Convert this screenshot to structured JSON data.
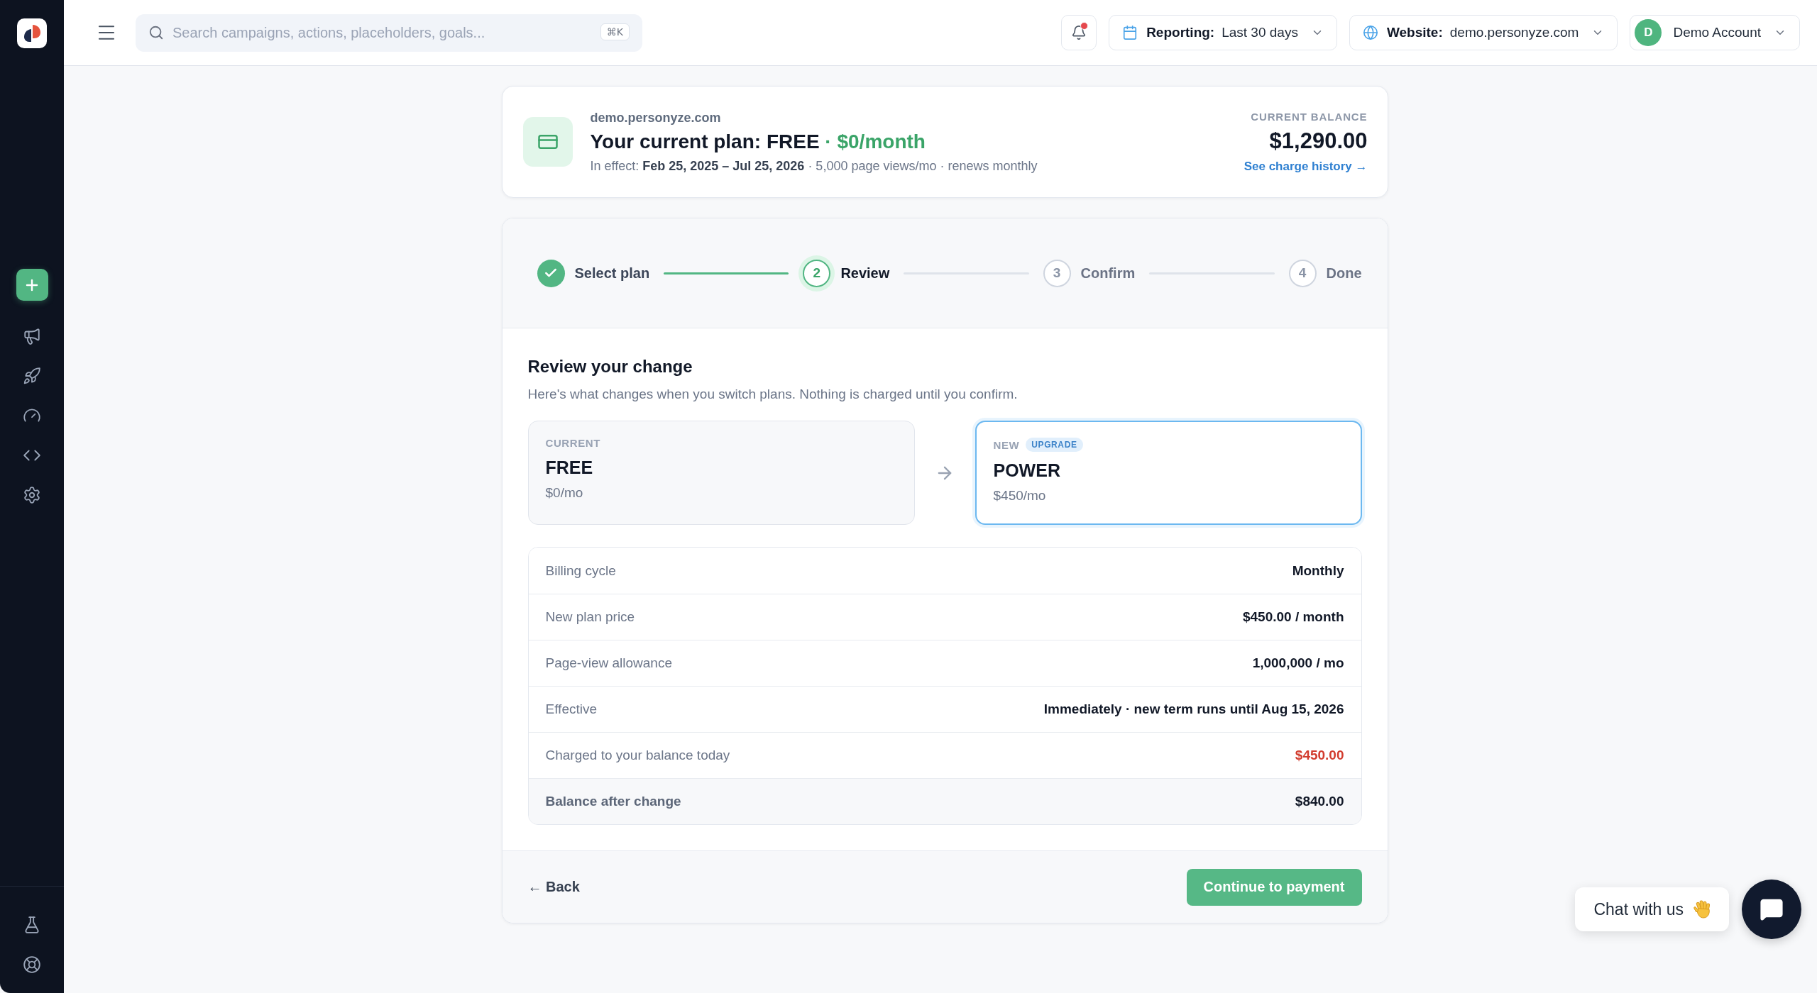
{
  "topbar": {
    "search": {
      "placeholder": "Search campaigns, actions, placeholders, goals...",
      "shortcut": "⌘K"
    },
    "notifications": {
      "unread": true
    },
    "reporting": {
      "label": "Reporting:",
      "value": "Last 30 days"
    },
    "website": {
      "label": "Website:",
      "value": "demo.personyze.com"
    },
    "account": {
      "initial": "D",
      "name": "Demo Account"
    }
  },
  "plan_summary": {
    "site": "demo.personyze.com",
    "title": "Your current plan: FREE",
    "price": "· $0/month",
    "meta": "In effect: **Feb 25, 2025 – Jul 25, 2026** · 5,000 page views/mo · renews monthly",
    "balance_label": "CURRENT BALANCE",
    "balance": "$1,290.00",
    "history_link": "See charge history →"
  },
  "steps": [
    {
      "label": "Select plan",
      "completed": true,
      "selected": false
    },
    {
      "number": "2",
      "label": "Review",
      "completed": false,
      "selected": true
    },
    {
      "number": "3",
      "label": "Confirm",
      "completed": false,
      "selected": false
    },
    {
      "number": "4",
      "label": "Done",
      "completed": false,
      "selected": false
    }
  ],
  "review": {
    "title": "Review your change",
    "subtitle": "Here's what changes when you switch plans. Nothing is charged until you confirm.",
    "plans": [
      {
        "tag": "CURRENT",
        "name": "FREE",
        "price": "$0/mo",
        "selected": false
      },
      {
        "tag": "NEW",
        "badge": "UPGRADE",
        "name": "POWER",
        "price": "$450/mo",
        "selected": true
      }
    ],
    "rows": [
      {
        "label": "Billing cycle",
        "value": "Monthly",
        "kind": "detail"
      },
      {
        "label": "New plan price",
        "value": "$450.00 / month",
        "kind": "detail"
      },
      {
        "label": "Page-view allowance",
        "value": "1,000,000 / mo",
        "kind": "detail"
      },
      {
        "label": "Effective",
        "value": "Immediately · new term runs until Aug 15, 2026",
        "kind": "detail"
      },
      {
        "label": "Charged to your balance today",
        "value": "$450.00",
        "kind": "charge"
      },
      {
        "label": "Balance after change",
        "value": "$840.00",
        "kind": "total"
      }
    ]
  },
  "actions": {
    "back": "← Back",
    "continue": "Continue to payment"
  },
  "chat": {
    "label": "Chat with us"
  }
}
